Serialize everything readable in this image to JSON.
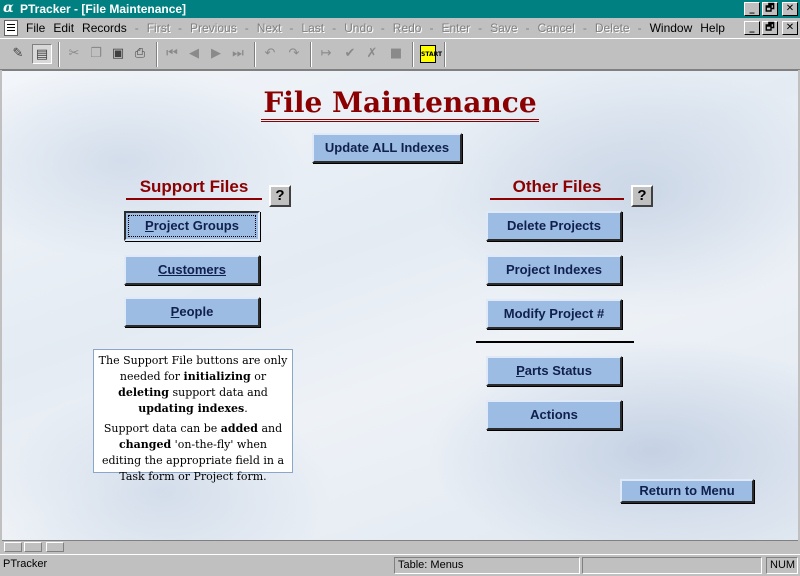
{
  "window": {
    "title": "PTracker - [File Maintenance]",
    "app_glyph": "α",
    "controls": {
      "minimize": "_",
      "restore": "🗗",
      "close": "✕"
    }
  },
  "menubar": {
    "items": [
      {
        "label": "File",
        "enabled": true
      },
      {
        "label": "Edit",
        "enabled": true
      },
      {
        "label": "Records",
        "enabled": true
      },
      {
        "label": "First",
        "enabled": false
      },
      {
        "label": "Previous",
        "enabled": false
      },
      {
        "label": "Next",
        "enabled": false
      },
      {
        "label": "Last",
        "enabled": false
      },
      {
        "label": "Undo",
        "enabled": false
      },
      {
        "label": "Redo",
        "enabled": false
      },
      {
        "label": "Enter",
        "enabled": false
      },
      {
        "label": "Save",
        "enabled": false
      },
      {
        "label": "Cancel",
        "enabled": false
      },
      {
        "label": "Delete",
        "enabled": false
      },
      {
        "label": "Window",
        "enabled": true
      },
      {
        "label": "Help",
        "enabled": true
      }
    ]
  },
  "toolbar": {
    "icons": [
      "design-icon",
      "form-view-icon",
      "cut-icon",
      "copy-icon",
      "paste-icon",
      "print-icon",
      "first-record-icon",
      "previous-record-icon",
      "next-record-icon",
      "last-record-icon",
      "undo-icon",
      "redo-icon",
      "enter-icon",
      "save-icon",
      "cancel-icon",
      "stop-icon",
      "start-icon"
    ],
    "start_label": "START"
  },
  "page": {
    "title": "File Maintenance",
    "update_all_label": "Update ALL Indexes",
    "help_label": "?",
    "return_label": "Return to Menu"
  },
  "support_files": {
    "title": "Support Files",
    "buttons": [
      {
        "label": "Project Groups",
        "mnemonic": "P"
      },
      {
        "label": "Customers",
        "mnemonic": ""
      },
      {
        "label": "People",
        "mnemonic": "P"
      }
    ]
  },
  "other_files": {
    "title": "Other Files",
    "buttons": [
      {
        "label": "Delete Projects"
      },
      {
        "label": "Project Indexes"
      },
      {
        "label": "Modify Project #"
      },
      {
        "label": "Parts Status"
      },
      {
        "label": "Actions"
      }
    ]
  },
  "info": {
    "p1_a": "The Support File buttons are only needed for ",
    "p1_b": "initializing",
    "p1_c": " or ",
    "p1_d": "deleting",
    "p1_e": " support data and ",
    "p1_f": "updating indexes",
    "p1_g": ".",
    "p2_a": "Support data can be ",
    "p2_b": "added",
    "p2_c": " and ",
    "p2_d": "changed",
    "p2_e": " 'on-the-fly' when editing the appropriate field in a Task form or Project form."
  },
  "statusbar": {
    "app": "PTracker",
    "table": "Table: Menus",
    "num": "NUM"
  }
}
